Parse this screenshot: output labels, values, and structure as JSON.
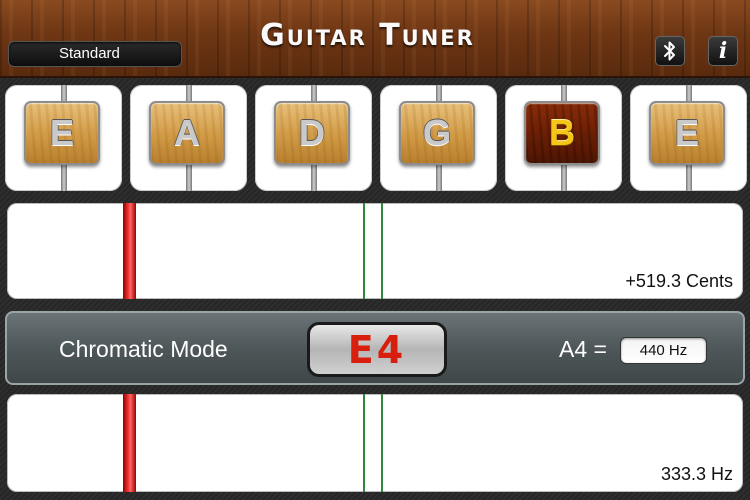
{
  "header": {
    "title": "Guitar Tuner",
    "preset": "Standard",
    "info_label": "i",
    "bluetooth_icon": "bluetooth-icon",
    "info_icon": "info-icon",
    "accent_color": "#6e3614"
  },
  "strings": [
    {
      "note": "E",
      "active": false
    },
    {
      "note": "A",
      "active": false
    },
    {
      "note": "D",
      "active": false
    },
    {
      "note": "G",
      "active": false
    },
    {
      "note": "B",
      "active": true
    },
    {
      "note": "E",
      "active": false
    }
  ],
  "cents_meter": {
    "readout": "+519.3 Cents",
    "needle_color": "#ff3b3b",
    "center_color": "#2e8a3a"
  },
  "mode": {
    "label": "Chromatic Mode",
    "note": "E4",
    "note_color": "#d81e0c",
    "reference_label": "A4 =",
    "reference_value": "440 Hz"
  },
  "frequency_meter": {
    "readout": "333.3 Hz"
  }
}
